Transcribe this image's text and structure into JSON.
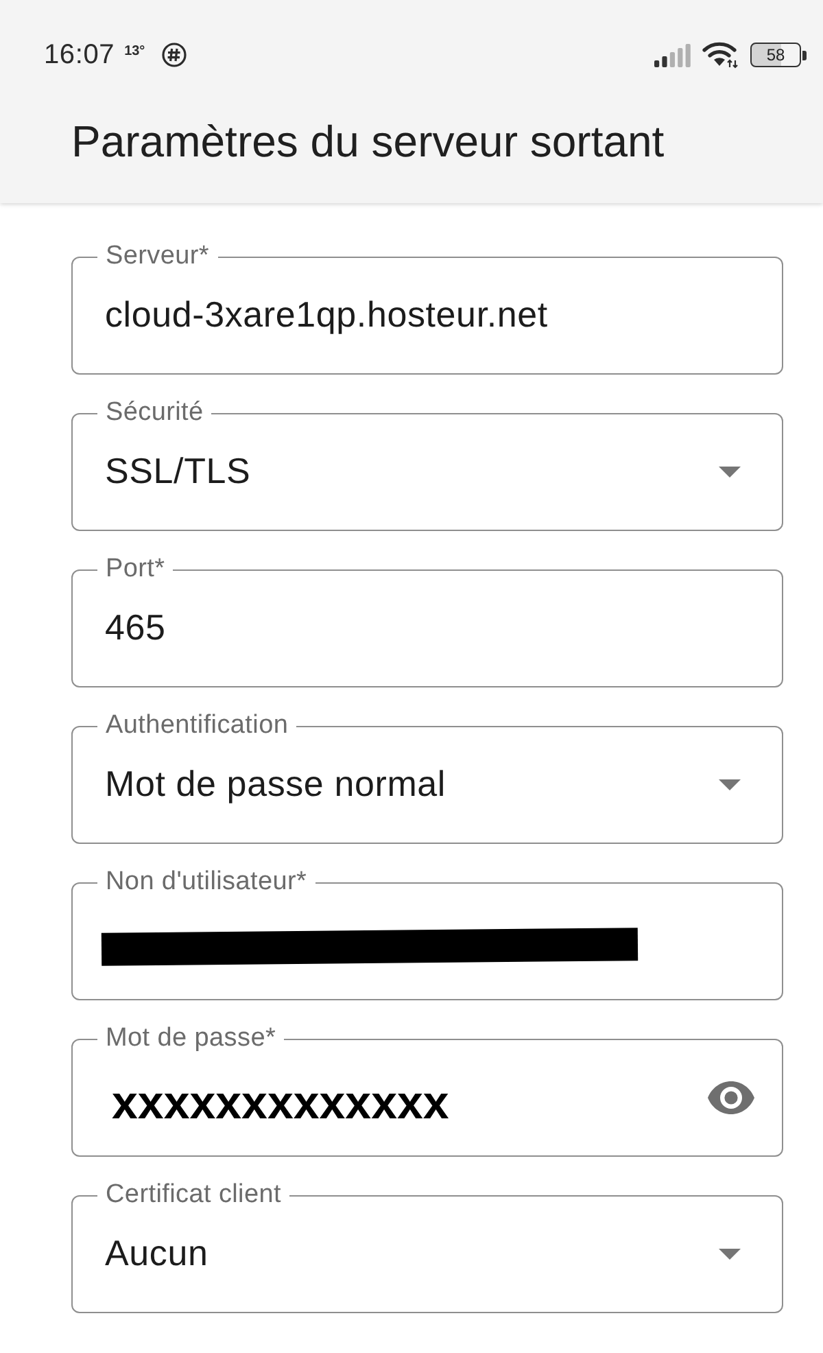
{
  "status_bar": {
    "time": "16:07",
    "temperature": "13°",
    "battery": "58"
  },
  "app_bar": {
    "title": "Paramètres du serveur sortant"
  },
  "fields": [
    {
      "kind": "text",
      "label": "Serveur*",
      "value": "cloud-3xare1qp.hosteur.net",
      "redacted": false
    },
    {
      "kind": "select",
      "label": "Sécurité",
      "value": "SSL/TLS",
      "redacted": false
    },
    {
      "kind": "text",
      "label": "Port*",
      "value": "465",
      "redacted": false
    },
    {
      "kind": "select",
      "label": "Authentification",
      "value": "Mot de passe normal",
      "redacted": false
    },
    {
      "kind": "text",
      "label": "Non d'utilisateur*",
      "redacted": true
    },
    {
      "kind": "password",
      "label": "Mot de passe*",
      "value": "xxxxxxxxxxxxx",
      "redacted": false
    },
    {
      "kind": "select",
      "label": "Certificat client",
      "value": "Aucun",
      "redacted": false
    }
  ]
}
